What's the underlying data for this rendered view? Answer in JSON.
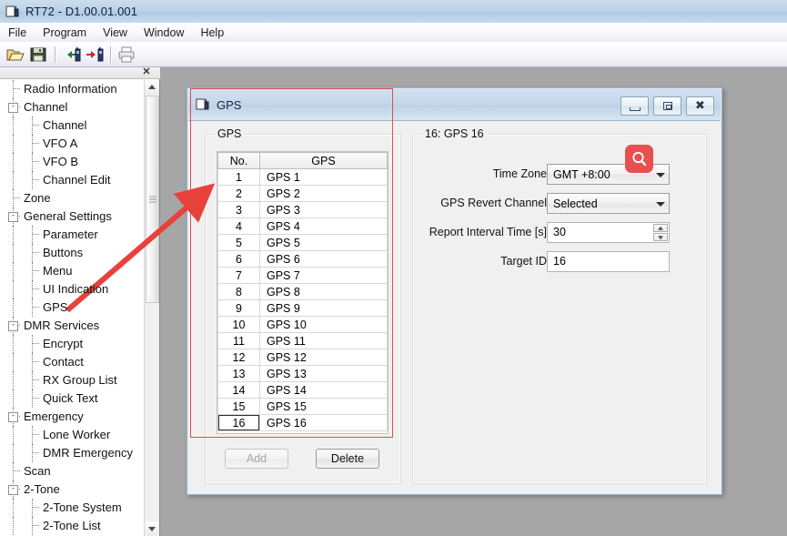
{
  "window": {
    "title": "RT72 - D1.00.01.001",
    "icon": "radio-app-icon"
  },
  "menubar": {
    "items": [
      {
        "label": "File",
        "name": "menu-file"
      },
      {
        "label": "Program",
        "name": "menu-program"
      },
      {
        "label": "View",
        "name": "menu-view"
      },
      {
        "label": "Window",
        "name": "menu-window"
      },
      {
        "label": "Help",
        "name": "menu-help"
      }
    ]
  },
  "toolbar": {
    "buttons": [
      {
        "icon": "open-folder-icon",
        "name": "open-button"
      },
      {
        "icon": "save-disk-icon",
        "name": "save-button"
      },
      {
        "icon": "read-from-radio-icon",
        "name": "read-from-radio-button"
      },
      {
        "icon": "write-to-radio-icon",
        "name": "write-to-radio-button"
      },
      {
        "icon": "print-icon",
        "name": "print-button"
      }
    ]
  },
  "sidebar": {
    "close_label": "✕",
    "items": [
      {
        "label": "Radio Information",
        "level": 0,
        "expander": ""
      },
      {
        "label": "Channel",
        "level": 0,
        "expander": "-"
      },
      {
        "label": "Channel",
        "level": 1,
        "expander": ""
      },
      {
        "label": "VFO A",
        "level": 1,
        "expander": ""
      },
      {
        "label": "VFO B",
        "level": 1,
        "expander": ""
      },
      {
        "label": "Channel Edit",
        "level": 1,
        "expander": ""
      },
      {
        "label": "Zone",
        "level": 0,
        "expander": ""
      },
      {
        "label": "General Settings",
        "level": 0,
        "expander": "-"
      },
      {
        "label": "Parameter",
        "level": 1,
        "expander": ""
      },
      {
        "label": "Buttons",
        "level": 1,
        "expander": ""
      },
      {
        "label": "Menu",
        "level": 1,
        "expander": ""
      },
      {
        "label": "UI Indication",
        "level": 1,
        "expander": ""
      },
      {
        "label": "GPS",
        "level": 1,
        "expander": ""
      },
      {
        "label": "DMR Services",
        "level": 0,
        "expander": "-"
      },
      {
        "label": "Encrypt",
        "level": 1,
        "expander": ""
      },
      {
        "label": "Contact",
        "level": 1,
        "expander": ""
      },
      {
        "label": "RX Group List",
        "level": 1,
        "expander": ""
      },
      {
        "label": "Quick Text",
        "level": 1,
        "expander": ""
      },
      {
        "label": "Emergency",
        "level": 0,
        "expander": "-"
      },
      {
        "label": "Lone Worker",
        "level": 1,
        "expander": ""
      },
      {
        "label": "DMR Emergency",
        "level": 1,
        "expander": ""
      },
      {
        "label": "Scan",
        "level": 0,
        "expander": ""
      },
      {
        "label": "2-Tone",
        "level": 0,
        "expander": "-"
      },
      {
        "label": "2-Tone System",
        "level": 1,
        "expander": ""
      },
      {
        "label": "2-Tone List",
        "level": 1,
        "expander": ""
      }
    ]
  },
  "dialog": {
    "title": "GPS",
    "icon": "radio-app-icon",
    "controls": {
      "minimize": "minimize-button",
      "maximize": "maximize-button",
      "close": "close-button"
    },
    "list_group": {
      "caption": "GPS",
      "columns": [
        "No.",
        "GPS"
      ],
      "rows": [
        {
          "no": "1",
          "gps": "GPS 1"
        },
        {
          "no": "2",
          "gps": "GPS 2"
        },
        {
          "no": "3",
          "gps": "GPS 3"
        },
        {
          "no": "4",
          "gps": "GPS 4"
        },
        {
          "no": "5",
          "gps": "GPS 5"
        },
        {
          "no": "6",
          "gps": "GPS 6"
        },
        {
          "no": "7",
          "gps": "GPS 7"
        },
        {
          "no": "8",
          "gps": "GPS 8"
        },
        {
          "no": "9",
          "gps": "GPS 9"
        },
        {
          "no": "10",
          "gps": "GPS 10"
        },
        {
          "no": "11",
          "gps": "GPS 11"
        },
        {
          "no": "12",
          "gps": "GPS 12"
        },
        {
          "no": "13",
          "gps": "GPS 13"
        },
        {
          "no": "14",
          "gps": "GPS 14"
        },
        {
          "no": "15",
          "gps": "GPS 15"
        },
        {
          "no": "16",
          "gps": "GPS 16"
        }
      ],
      "selected_index": 15,
      "add_label": "Add",
      "add_enabled": false,
      "delete_label": "Delete",
      "delete_enabled": true
    },
    "detail_group": {
      "caption": "16: GPS 16",
      "fields": [
        {
          "label": "Time Zone",
          "value": "GMT +8:00",
          "type": "combo",
          "name": "time-zone"
        },
        {
          "label": "GPS Revert Channel",
          "value": "Selected",
          "type": "combo",
          "name": "gps-revert-channel"
        },
        {
          "label": "Report Interval Time [s]",
          "value": "30",
          "type": "spinner",
          "name": "report-interval-time"
        },
        {
          "label": "Target ID",
          "value": "16",
          "type": "text",
          "name": "target-id"
        }
      ]
    }
  },
  "annotations": {
    "highlight_color": "#e05050",
    "cursor_color": "#e8504f",
    "cursor_icon": "magnifier-icon"
  }
}
